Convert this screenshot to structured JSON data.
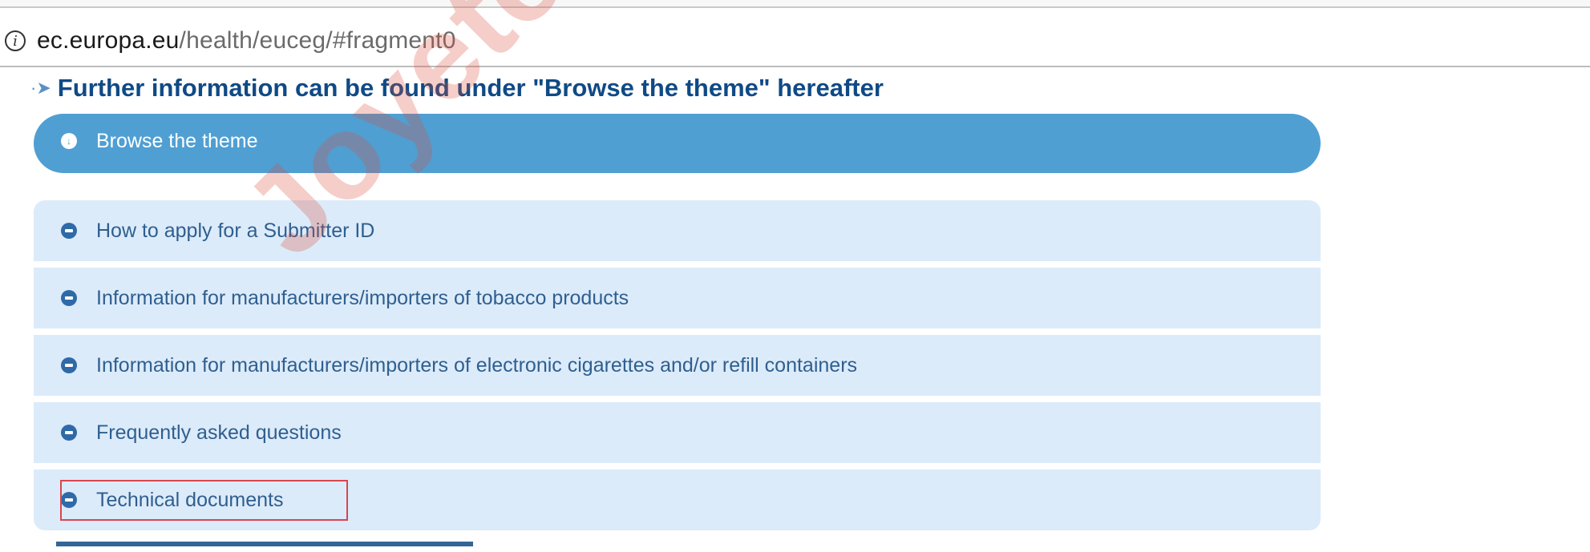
{
  "browser": {
    "url_domain": "ec.europa.eu",
    "url_path": "/health/euceg/#fragment0",
    "info_icon": "i"
  },
  "heading": {
    "icon": "arrow-icon",
    "text": "Further information can be found under \"Browse the theme\" hereafter"
  },
  "browse_bar": {
    "label": "Browse the theme",
    "icon": "down-arrow-circle-icon"
  },
  "items": [
    {
      "label": "How to apply for a Submitter ID"
    },
    {
      "label": "Information for manufacturers/importers of tobacco products"
    },
    {
      "label": "Information for manufacturers/importers of electronic cigarettes and/or refill containers"
    },
    {
      "label": "Frequently asked questions"
    },
    {
      "label": "Technical  documents"
    }
  ],
  "watermark": "Joyetech",
  "colors": {
    "heading": "#0f4a85",
    "browse_bar": "#4f9fd3",
    "list_bg": "#dcebfa",
    "list_text": "#2f5f8f",
    "highlight": "#d9464e"
  }
}
